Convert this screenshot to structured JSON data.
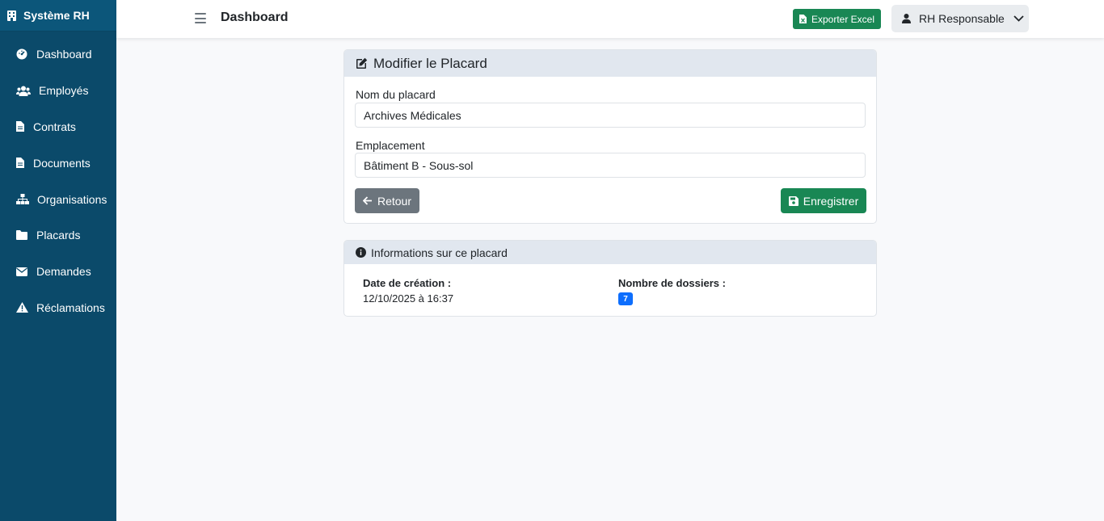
{
  "sidebar": {
    "brand": "Système RH",
    "items": [
      {
        "label": "Dashboard",
        "icon": "gauge-icon"
      },
      {
        "label": "Employés",
        "icon": "users-icon"
      },
      {
        "label": "Contrats",
        "icon": "file-icon"
      },
      {
        "label": "Documents",
        "icon": "file-icon"
      },
      {
        "label": "Organisations",
        "icon": "sitemap-icon"
      },
      {
        "label": "Placards",
        "icon": "folder-icon"
      },
      {
        "label": "Demandes",
        "icon": "envelope-icon"
      },
      {
        "label": "Réclamations",
        "icon": "warning-icon"
      }
    ]
  },
  "topbar": {
    "title": "Dashboard",
    "export_label": "Exporter Excel",
    "user_label": "RH Responsable"
  },
  "form": {
    "title": "Modifier le Placard",
    "name_label": "Nom du placard",
    "name_value": "Archives Médicales",
    "location_label": "Emplacement",
    "location_value": "Bâtiment B - Sous-sol",
    "back_label": "Retour",
    "save_label": "Enregistrer"
  },
  "info": {
    "title": "Informations sur ce placard",
    "created_label": "Date de création :",
    "created_value": "12/10/2025 à 16:37",
    "folders_label": "Nombre de dossiers :",
    "folders_count": "7"
  },
  "colors": {
    "sidebar_bg": "#0b4a6a",
    "success": "#198754",
    "secondary": "#6c757d",
    "primary": "#0d6efd"
  }
}
